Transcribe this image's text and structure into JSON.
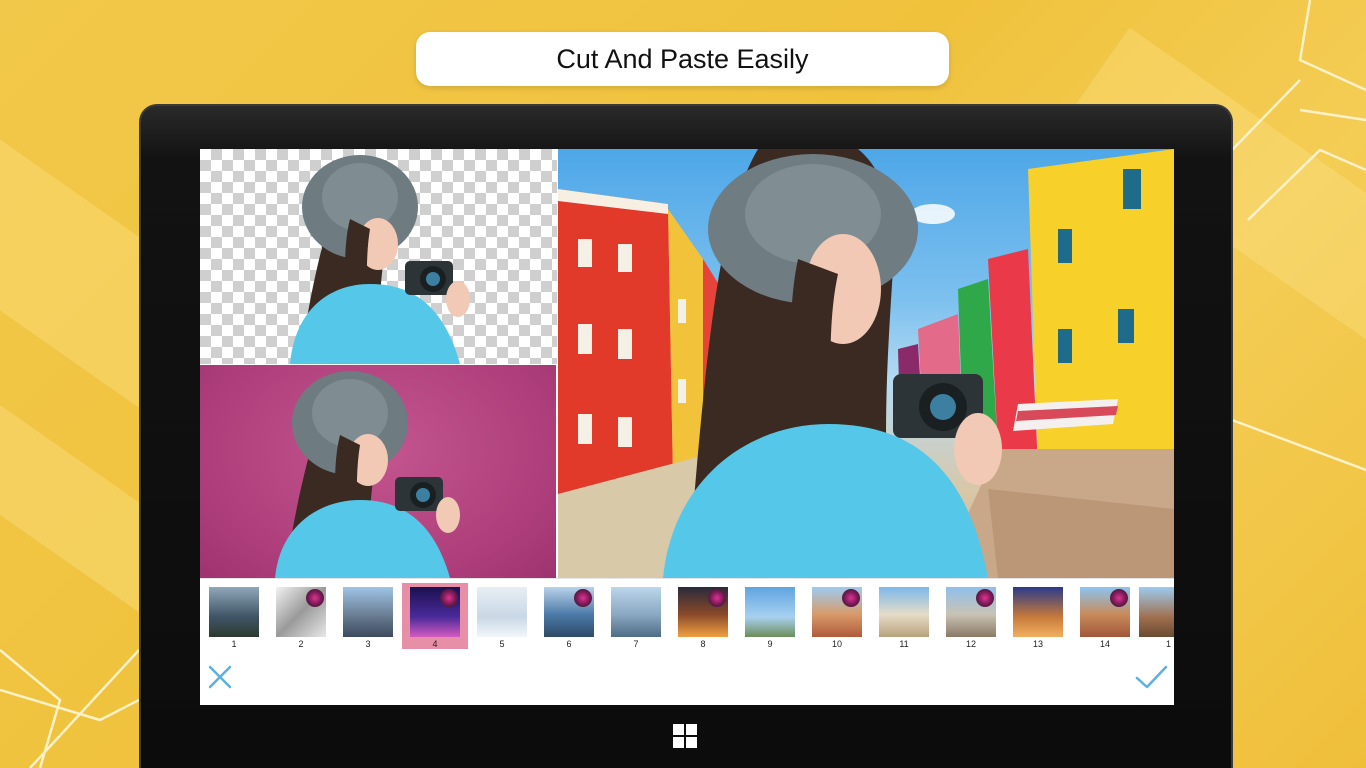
{
  "headline": "Cut And Paste Easily",
  "colors": {
    "background": "#f0c23c",
    "accent": "#5db0e0",
    "selected_thumb": "#e88fa8",
    "pink_backdrop": "#ad3e7b"
  },
  "panels": {
    "transparent_label": "transparent-background-cutout",
    "pink_label": "pink-background-cutout",
    "scene_label": "colorful-street-composite"
  },
  "thumbnails": [
    {
      "num": "1",
      "bg": "linear-gradient(180deg,#8fa7b8,#3f5566 60%,#2c3a2e)",
      "dot": false
    },
    {
      "num": "2",
      "bg": "linear-gradient(135deg,#f2f2f2,#9a9a9a 50%,#e8e8e8)",
      "dot": true
    },
    {
      "num": "3",
      "bg": "linear-gradient(180deg,#9fc4e6,#6c7f95 55%,#3c4a5c)",
      "dot": false
    },
    {
      "num": "4",
      "bg": "linear-gradient(180deg,#1a1050,#4a2a9a 60%,#d45ac0)",
      "dot": true
    },
    {
      "num": "5",
      "bg": "linear-gradient(180deg,#e8eef4,#c9d8e6 60%,#f2f6f9)",
      "dot": false
    },
    {
      "num": "6",
      "bg": "linear-gradient(180deg,#b9d2ea,#4c7aa8 55%,#2e4a66)",
      "dot": true
    },
    {
      "num": "7",
      "bg": "linear-gradient(180deg,#bcd6ea,#8aa8c2 55%,#4f6c86)",
      "dot": false
    },
    {
      "num": "8",
      "bg": "linear-gradient(180deg,#2a2a3a,#8a4a2a 55%,#f0a040)",
      "dot": true
    },
    {
      "num": "9",
      "bg": "linear-gradient(180deg,#5fa4e0,#a8d0ef 60%,#6b8e5a)",
      "dot": false
    },
    {
      "num": "10",
      "bg": "linear-gradient(180deg,#9ecbf0,#d89a6a 55%,#b05a3a)",
      "dot": true
    },
    {
      "num": "11",
      "bg": "linear-gradient(180deg,#7db8ea,#e6dcc8 55%,#b8a27c)",
      "dot": false
    },
    {
      "num": "12",
      "bg": "linear-gradient(180deg,#8fc0ea,#c9c2b4 55%,#8a7a64)",
      "dot": true
    },
    {
      "num": "13",
      "bg": "linear-gradient(180deg,#2a3a8a,#c87a3a 60%,#f0b060)",
      "dot": false
    },
    {
      "num": "14",
      "bg": "linear-gradient(180deg,#8cc4f0,#c88a5a 55%,#a0583a)",
      "dot": true
    },
    {
      "num": "1",
      "bg": "linear-gradient(180deg,#9ccaf0,#a07050 60%,#6a4a30)",
      "dot": false
    }
  ],
  "actions": {
    "cancel_icon": "close-icon",
    "confirm_icon": "check-icon"
  }
}
